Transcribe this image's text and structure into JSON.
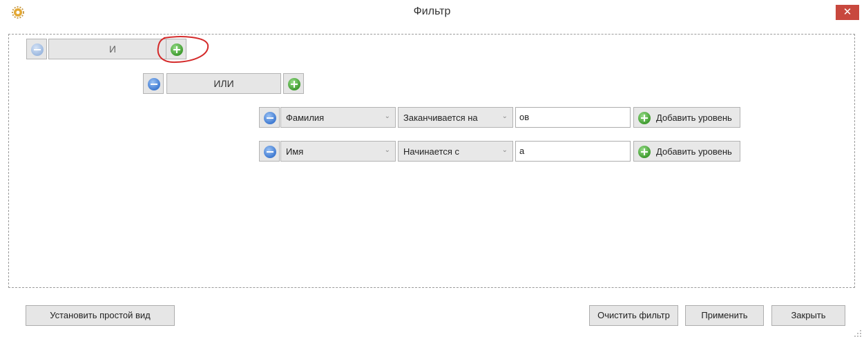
{
  "window": {
    "title": "Фильтр",
    "close_glyph": "✕",
    "app_icon": "gear-icon"
  },
  "root_group": {
    "operator": "И"
  },
  "sub_group": {
    "operator": "ИЛИ"
  },
  "conditions": [
    {
      "field": "Фамилия",
      "operator": "Заканчивается на",
      "value": "ов",
      "add_label": "Добавить уровень"
    },
    {
      "field": "Имя",
      "operator": "Начинается с",
      "value": "а",
      "add_label": "Добавить уровень"
    }
  ],
  "footer": {
    "simple_view": "Установить простой вид",
    "clear": "Очистить фильтр",
    "apply": "Применить",
    "close": "Закрыть"
  },
  "colors": {
    "close_button": "#c8483e",
    "highlight": "#d42a2a"
  }
}
